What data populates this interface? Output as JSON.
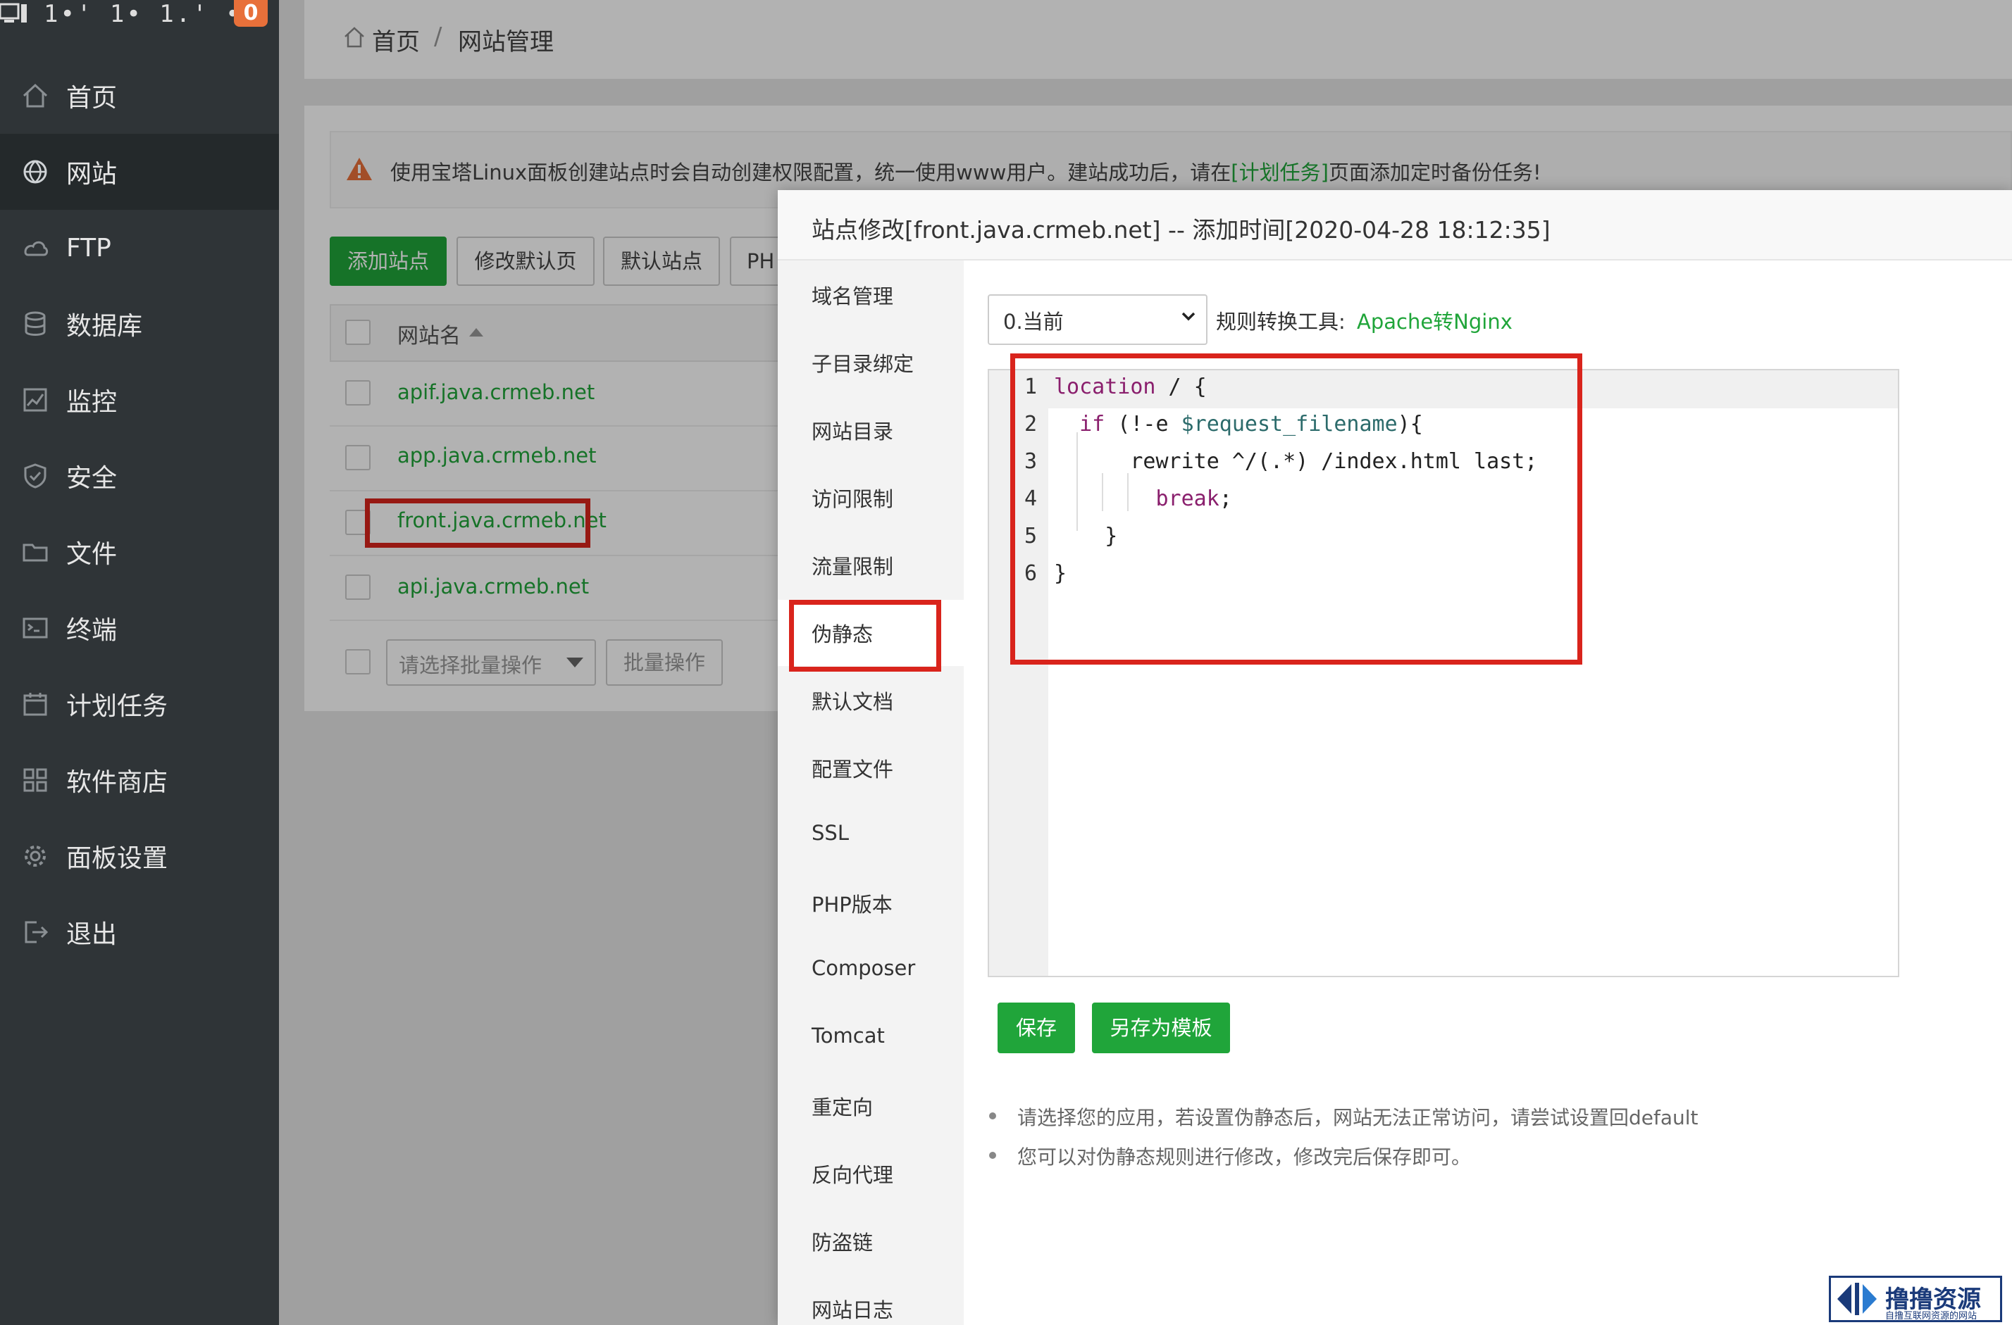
{
  "sidebar": {
    "server_ip": "1•' 1• 1.' ••",
    "alert_count": "0",
    "items": [
      {
        "label": "首页",
        "icon": "home-icon"
      },
      {
        "label": "网站",
        "icon": "globe-icon"
      },
      {
        "label": "FTP",
        "icon": "ftp-icon"
      },
      {
        "label": "数据库",
        "icon": "database-icon"
      },
      {
        "label": "监控",
        "icon": "monitor-icon"
      },
      {
        "label": "安全",
        "icon": "shield-icon"
      },
      {
        "label": "文件",
        "icon": "folder-icon"
      },
      {
        "label": "终端",
        "icon": "terminal-icon"
      },
      {
        "label": "计划任务",
        "icon": "calendar-icon"
      },
      {
        "label": "软件商店",
        "icon": "grid-icon"
      },
      {
        "label": "面板设置",
        "icon": "gear-icon"
      },
      {
        "label": "退出",
        "icon": "logout-icon"
      }
    ],
    "active_index": 1
  },
  "breadcrumb": {
    "home": "首页",
    "separator": "/",
    "current": "网站管理"
  },
  "notice": {
    "text_before": "使用宝塔Linux面板创建站点时会自动创建权限配置，统一使用www用户。建站成功后，请在",
    "link": "[计划任务]",
    "text_after": "页面添加定时备份任务!"
  },
  "toolbar": {
    "add_site": "添加站点",
    "edit_default_page": "修改默认页",
    "default_site": "默认站点",
    "php_cut": "PH"
  },
  "table": {
    "header": "网站名",
    "rows": [
      "apif.java.crmeb.net",
      "app.java.crmeb.net",
      "front.java.crmeb.net",
      "api.java.crmeb.net"
    ],
    "batch_placeholder": "请选择批量操作",
    "batch_button": "批量操作"
  },
  "modal": {
    "title": "站点修改[front.java.crmeb.net] -- 添加时间[2020-04-28 18:12:35]",
    "nav": [
      "域名管理",
      "子目录绑定",
      "网站目录",
      "访问限制",
      "流量限制",
      "伪静态",
      "默认文档",
      "配置文件",
      "SSL",
      "PHP版本",
      "Composer",
      "Tomcat",
      "重定向",
      "反向代理",
      "防盗链",
      "网站日志"
    ],
    "active_nav": "伪静态",
    "rule_select_value": "0.当前",
    "rule_tool_label": "规则转换工具:",
    "rule_tool_link": "Apache转Nginx",
    "code_lines": [
      {
        "n": "1",
        "parts": [
          [
            "kw",
            "location"
          ],
          [
            "",
            " / {"
          ]
        ]
      },
      {
        "n": "2",
        "parts": [
          [
            "",
            "  "
          ],
          [
            "kw",
            "if"
          ],
          [
            "",
            " (!-e "
          ],
          [
            "var",
            "$request_filename"
          ],
          [
            "",
            "){"
          ]
        ]
      },
      {
        "n": "3",
        "parts": [
          [
            "",
            "      rewrite ^/(.*) /index.html last;"
          ]
        ]
      },
      {
        "n": "4",
        "parts": [
          [
            "",
            "        "
          ],
          [
            "kw",
            "break"
          ],
          [
            "",
            ";"
          ]
        ]
      },
      {
        "n": "5",
        "parts": [
          [
            "",
            "    }"
          ]
        ]
      },
      {
        "n": "6",
        "parts": [
          [
            "",
            "}"
          ]
        ]
      }
    ],
    "save_button": "保存",
    "save_template_button": "另存为模板",
    "notes": [
      "请选择您的应用，若设置伪静态后，网站无法正常访问，请尝试设置回default",
      "您可以对伪静态规则进行修改，修改完后保存即可。"
    ]
  },
  "watermark": {
    "text": "撸撸资源",
    "sub": "自撸互联网资源的网站"
  },
  "colors": {
    "accent_green": "#20a53a",
    "highlight_red": "#d9241c",
    "sidebar_bg": "#2f3437"
  }
}
